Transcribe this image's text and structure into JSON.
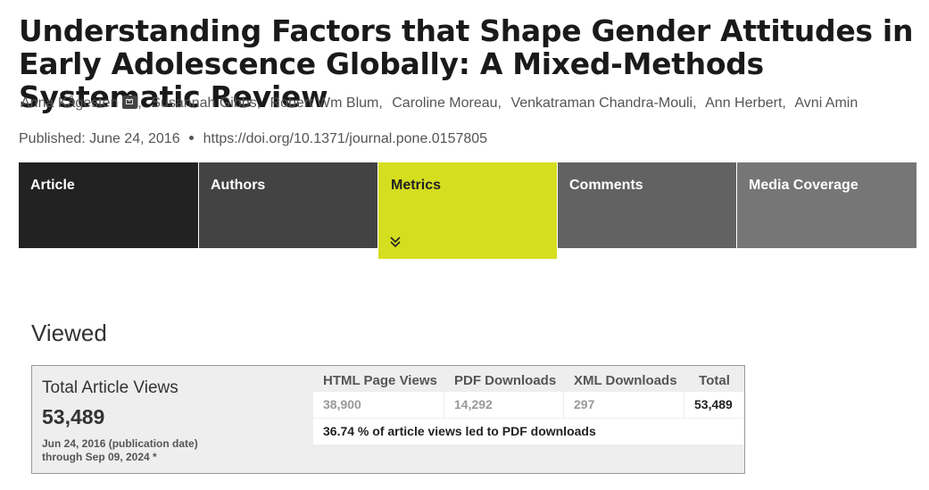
{
  "article": {
    "title": "Understanding Factors that Shape Gender Attitudes in Early Adolescence Globally: A Mixed-Methods Systematic Review",
    "authors": [
      {
        "name": "Anna Kågesten",
        "has_email": true
      },
      {
        "name": "Susannah Gibbs",
        "has_email": false
      },
      {
        "name": "Robert Wm Blum",
        "has_email": false
      },
      {
        "name": "Caroline Moreau",
        "has_email": false
      },
      {
        "name": "Venkatraman Chandra-Mouli",
        "has_email": false
      },
      {
        "name": "Ann Herbert",
        "has_email": false
      },
      {
        "name": "Avni Amin",
        "has_email": false
      }
    ],
    "published": "Published: June 24, 2016",
    "doi": "https://doi.org/10.1371/journal.pone.0157805"
  },
  "tabs": [
    {
      "label": "Article",
      "active": false,
      "color": "#222222"
    },
    {
      "label": "Authors",
      "active": false,
      "color": "#434343"
    },
    {
      "label": "Metrics",
      "active": true,
      "color": "#d5de1f"
    },
    {
      "label": "Comments",
      "active": false,
      "color": "#626262"
    },
    {
      "label": "Media Coverage",
      "active": false,
      "color": "#767676"
    }
  ],
  "metrics": {
    "section_heading": "Viewed",
    "total_label": "Total Article Views",
    "total_value": "53,489",
    "date_from": "Jun 24, 2016 (publication date)",
    "date_through": "through Sep 09, 2024 *",
    "columns": [
      "HTML Page Views",
      "PDF Downloads",
      "XML Downloads",
      "Total"
    ],
    "values": [
      "38,900",
      "14,292",
      "297",
      "53,489"
    ],
    "summary": "36.74 % of article views led to PDF downloads"
  }
}
